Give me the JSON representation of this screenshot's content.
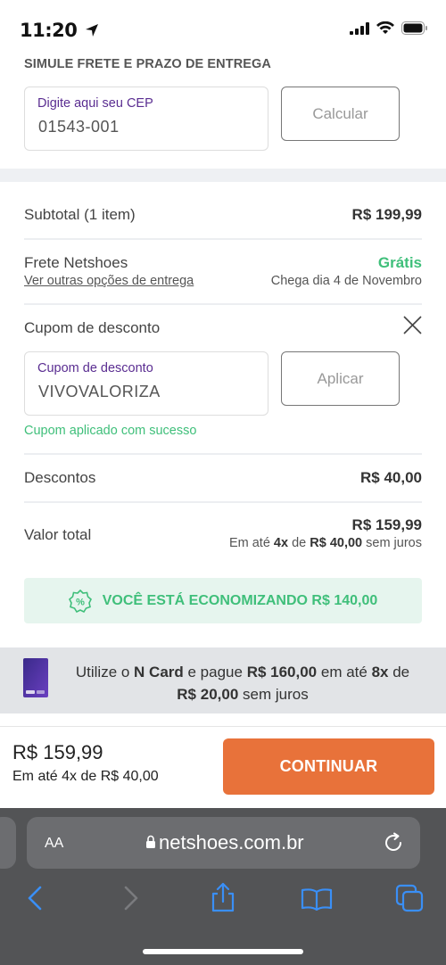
{
  "status_bar": {
    "time": "11:20"
  },
  "shipping": {
    "title": "SIMULE FRETE E PRAZO DE ENTREGA",
    "cep_label": "Digite aqui seu CEP",
    "cep_value": "01543-001",
    "calc_button": "Calcular"
  },
  "summary": {
    "subtotal_label": "Subtotal (1 item)",
    "subtotal_value": "R$ 199,99",
    "freight_label": "Frete Netshoes",
    "freight_value": "Grátis",
    "freight_link": "Ver outras opções de entrega",
    "delivery_date": "Chega dia 4 de Novembro"
  },
  "coupon": {
    "section_label": "Cupom de desconto",
    "field_label": "Cupom de desconto",
    "field_value": "VIVOVALORIZA",
    "apply_button": "Aplicar",
    "success_msg": "Cupom aplicado com sucesso"
  },
  "totals": {
    "discounts_label": "Descontos",
    "discounts_value": "R$ 40,00",
    "total_label": "Valor total",
    "total_value": "R$ 159,99",
    "inst_prefix": "Em até ",
    "inst_count": "4x",
    "inst_mid": " de ",
    "inst_amount": "R$ 40,00",
    "inst_suffix": " sem juros"
  },
  "economy": {
    "text": "VOCÊ ESTÁ ECONOMIZANDO R$ 140,00"
  },
  "ncard": {
    "p1": "Utilize o ",
    "b1": "N Card",
    "p2": " e pague ",
    "b2": "R$ 160,00",
    "p3": " em até ",
    "b3": "8x",
    "p4": " de ",
    "b4": "R$ 20,00",
    "p5": " sem juros"
  },
  "footer": {
    "price": "R$ 159,99",
    "installments": "Em até 4x de R$ 40,00",
    "continue_button": "CONTINUAR"
  },
  "browser": {
    "aa_label": "AA",
    "url": "netshoes.com.br"
  },
  "colors": {
    "accent_orange": "#e8723a",
    "success_green": "#3fbf7a",
    "label_purple": "#5a2d91"
  }
}
